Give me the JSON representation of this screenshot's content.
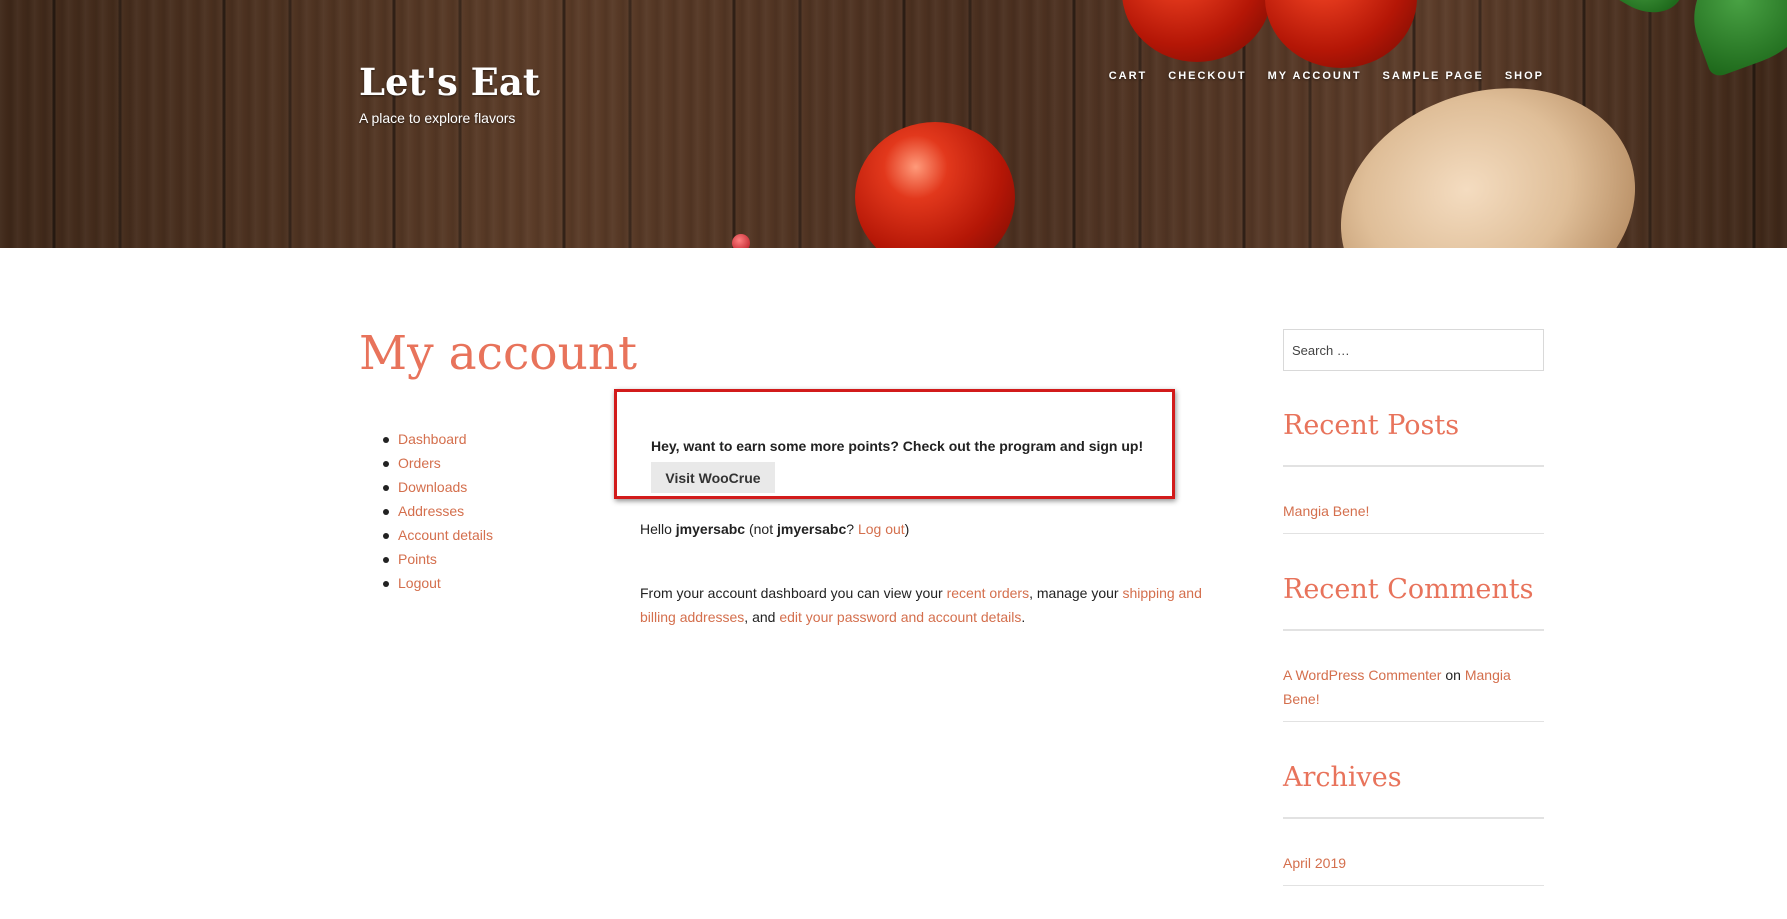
{
  "header": {
    "site_title": "Let's Eat",
    "tagline": "A place to explore flavors",
    "nav": [
      "CART",
      "CHECKOUT",
      "MY ACCOUNT",
      "SAMPLE PAGE",
      "SHOP"
    ]
  },
  "main": {
    "page_title": "My account",
    "account_nav": [
      "Dashboard",
      "Orders",
      "Downloads",
      "Addresses",
      "Account details",
      "Points",
      "Logout"
    ],
    "promo": {
      "text": "Hey, want to earn some more points? Check out the program and sign up!",
      "button": "Visit WooCrue"
    },
    "greeting": {
      "hello": "Hello ",
      "user": "jmyersabc",
      "open_not": " (not ",
      "user2": "jmyersabc",
      "question": "? ",
      "logout_link": "Log out",
      "close": ")"
    },
    "dashboard": {
      "part1": "From your account dashboard you can view your ",
      "link_recent_orders": "recent orders",
      "part2": ", manage your ",
      "link_addresses": "shipping and billing addresses",
      "part3": ", and ",
      "link_account": "edit your password and account details",
      "part4": "."
    }
  },
  "sidebar": {
    "search_placeholder": "Search …",
    "recent_posts_title": "Recent Posts",
    "recent_posts": [
      "Mangia Bene!"
    ],
    "recent_comments_title": "Recent Comments",
    "comment": {
      "author": "A WordPress Commenter",
      "on": " on ",
      "post": "Mangia Bene!"
    },
    "archives_title": "Archives",
    "archives": [
      "April 2019"
    ]
  },
  "colors": {
    "accent": "#e8735b",
    "link": "#d46f4d",
    "highlight_border": "#d21b1b"
  }
}
